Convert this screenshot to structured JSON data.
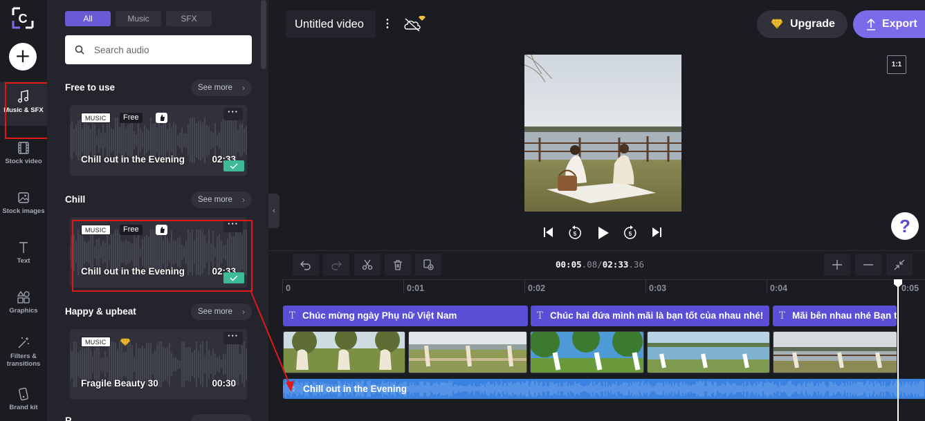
{
  "app": {
    "logo_letter": "C"
  },
  "rail": {
    "items": [
      {
        "label": "Music & SFX",
        "icon": "music-note-icon"
      },
      {
        "label": "Stock video",
        "icon": "film-icon"
      },
      {
        "label": "Stock images",
        "icon": "image-icon"
      },
      {
        "label": "Text",
        "icon": "text-icon"
      },
      {
        "label": "Graphics",
        "icon": "shapes-icon"
      },
      {
        "label": "Filters &\ntransitions",
        "label_l1": "Filters &",
        "label_l2": "transitions",
        "icon": "magic-wand-icon"
      },
      {
        "label": "Brand kit",
        "icon": "brand-kit-icon"
      }
    ]
  },
  "panel": {
    "tabs": [
      "All",
      "Music",
      "SFX"
    ],
    "active_tab": "All",
    "search_placeholder": "Search audio",
    "see_more": "See more",
    "sections": [
      {
        "title": "Free to use",
        "card": {
          "type": "MUSIC",
          "badge": "Free",
          "title": "Chill out in the Evening",
          "duration": "02:33",
          "added": true
        }
      },
      {
        "title": "Chill",
        "card": {
          "type": "MUSIC",
          "badge": "Free",
          "title": "Chill out in the Evening",
          "duration": "02:33",
          "added": true
        }
      },
      {
        "title": "Happy & upbeat",
        "card": {
          "type": "MUSIC",
          "badge": "premium-gem-icon",
          "title": "Fragile Beauty 30",
          "duration": "00:30",
          "added": false
        }
      },
      {
        "title": "R"
      }
    ]
  },
  "header": {
    "title": "Untitled video",
    "upgrade": "Upgrade",
    "export": "Export",
    "aspect_ratio": "1:1",
    "help": "?"
  },
  "timeline": {
    "current_time": "00:05",
    "current_frac": ".08",
    "separator": "/",
    "total_time": "02:33",
    "total_frac": ".36",
    "ruler": [
      "0",
      "0:01",
      "0:02",
      "0:03",
      "0:04",
      "0:05"
    ],
    "text_clips": [
      "Chúc mừng ngày Phụ nữ Việt Nam",
      "Chúc hai đứa mình mãi là bạn tốt của nhau nhé!",
      "Mãi bên nhau nhé Bạn t"
    ],
    "audio_clip": "Chill out in the Evening"
  },
  "colors": {
    "accent": "#7c6be8",
    "text_clip": "#5b4ed6",
    "audio_clip": "#3b82e0",
    "added_check": "#3dbb94",
    "highlight": "#e01818"
  }
}
